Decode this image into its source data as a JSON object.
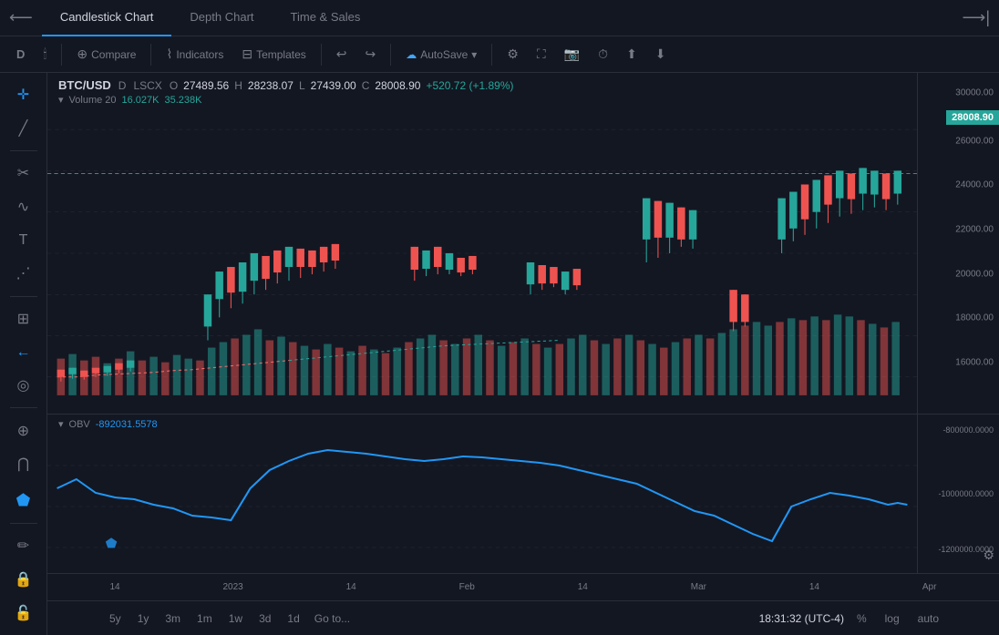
{
  "tabs": {
    "candlestick": "Candlestick Chart",
    "depth": "Depth Chart",
    "time_sales": "Time & Sales"
  },
  "toolbar": {
    "period": "D",
    "compare": "Compare",
    "indicators": "Indicators",
    "templates": "Templates",
    "autosave": "AutoSave",
    "undo_icon": "↩",
    "redo_icon": "↪"
  },
  "price_info": {
    "symbol": "BTC/USD",
    "timeframe": "D",
    "exchange": "LSCX",
    "open_label": "O",
    "open_val": "27489.56",
    "high_label": "H",
    "high_val": "28238.07",
    "low_label": "L",
    "low_val": "27439.00",
    "close_label": "C",
    "close_val": "28008.90",
    "change": "+520.72 (+1.89%)",
    "vol_label": "Volume 20",
    "vol_val1": "16.027K",
    "vol_val2": "35.238K"
  },
  "current_price": "28008.90",
  "price_levels": {
    "main": [
      "30000.00",
      "28000.00",
      "26000.00",
      "24000.00",
      "22000.00",
      "20000.00",
      "18000.00",
      "16000.00"
    ],
    "obv": [
      "-800000.0000",
      "-1000000.0000",
      "-1200000.0000"
    ]
  },
  "time_labels": [
    "14",
    "2023",
    "14",
    "Feb",
    "14",
    "Mar",
    "14",
    "Apr"
  ],
  "obv": {
    "label": "OBV",
    "value": "-892031.5578"
  },
  "bottom_periods": [
    "5y",
    "1y",
    "3m",
    "1m",
    "1w",
    "3d",
    "1d"
  ],
  "goto_label": "Go to...",
  "time_utc": "18:31:32 (UTC-4)",
  "bottom_controls": [
    "%",
    "log",
    "auto"
  ],
  "tools": [
    "crosshair",
    "trend-line",
    "fib-tool",
    "text-tool",
    "node-tool",
    "measure-tool",
    "back-arrow",
    "alert-tool",
    "zoom-tool",
    "magnet-tool",
    "pencil-tool",
    "lock-tool",
    "lock2-tool"
  ]
}
